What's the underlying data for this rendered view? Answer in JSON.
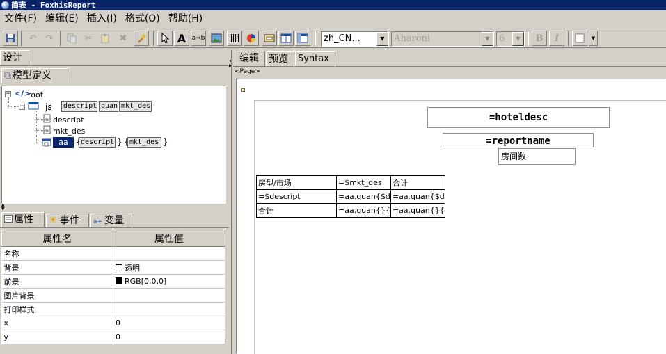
{
  "window": {
    "title": "简表 - FoxhisReport"
  },
  "menu": [
    "文件(F)",
    "编辑(E)",
    "插入(I)",
    "格式(O)",
    "帮助(H)"
  ],
  "toolbar": {
    "locale": "zh_CN...",
    "font_name": "Aharoni",
    "font_size": "6",
    "bold_label": "B",
    "italic_label": "I",
    "text_label": "A",
    "field_label": "a→b"
  },
  "left_panel": {
    "design_tab": "设计",
    "model_tab": "模型定义",
    "tree": {
      "root": "root",
      "js": "js",
      "js_fields": [
        "descript",
        "quan",
        "mkt_des"
      ],
      "child1": "descript",
      "child2": "mkt_des",
      "aa": "aa",
      "aa_fields": [
        "descript",
        "mkt_des"
      ]
    },
    "prop_tabs": [
      "属性",
      "事件",
      "变量"
    ],
    "prop_headers": [
      "属性名",
      "属性值"
    ],
    "props": [
      {
        "name": "名称",
        "value": ""
      },
      {
        "name": "背景",
        "value": "透明",
        "swatch": "#ffffff"
      },
      {
        "name": "前景",
        "value": "RGB[0,0,0]",
        "swatch": "#000000"
      },
      {
        "name": "图片背景",
        "value": ""
      },
      {
        "name": "打印样式",
        "value": ""
      },
      {
        "name": "x",
        "value": "0"
      },
      {
        "name": "y",
        "value": "0"
      }
    ]
  },
  "editor": {
    "tabs": [
      "编辑",
      "预览",
      "Syntax"
    ],
    "page_tag": "<Page>",
    "hotel_label": "=hoteldesc",
    "report_label": "=reportname",
    "rooms_label": "房间数",
    "grid": [
      [
        "房型/市场",
        "=$mkt_des",
        "合计"
      ],
      [
        "=$descript",
        "=aa.quan{$d",
        "=aa.quan{$d"
      ],
      [
        "合计",
        "=aa.quan{}{",
        "=aa.quan{}{"
      ]
    ]
  }
}
